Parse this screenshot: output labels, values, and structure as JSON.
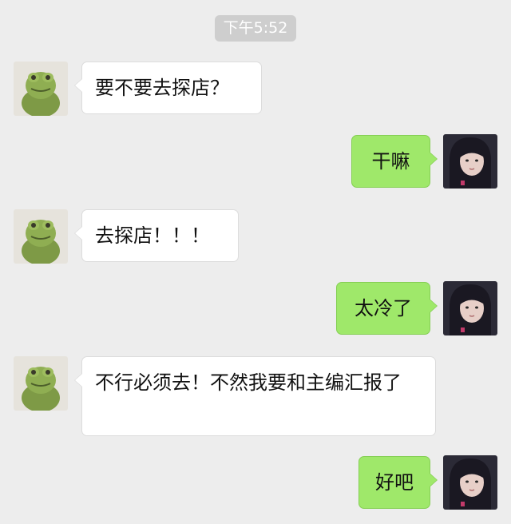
{
  "chat": {
    "timestamp": "下午5:52",
    "messages": [
      {
        "sender": "contact",
        "text": "要不要去探店？",
        "avatar_icon": "frog-plush-avatar-icon"
      },
      {
        "sender": "self",
        "text": "干嘛",
        "avatar_icon": "girl-avatar-icon"
      },
      {
        "sender": "contact",
        "text": "去探店！！！",
        "avatar_icon": "frog-plush-avatar-icon"
      },
      {
        "sender": "self",
        "text": "太冷了",
        "avatar_icon": "girl-avatar-icon"
      },
      {
        "sender": "contact",
        "text": "不行必须去！不然我要和主编汇报了",
        "avatar_icon": "frog-plush-avatar-icon"
      },
      {
        "sender": "self",
        "text": "好吧",
        "avatar_icon": "girl-avatar-icon"
      }
    ]
  },
  "colors": {
    "background": "#ededed",
    "incoming_bubble": "#ffffff",
    "outgoing_bubble": "#9fe86a",
    "timestamp_bg": "#cecece"
  }
}
